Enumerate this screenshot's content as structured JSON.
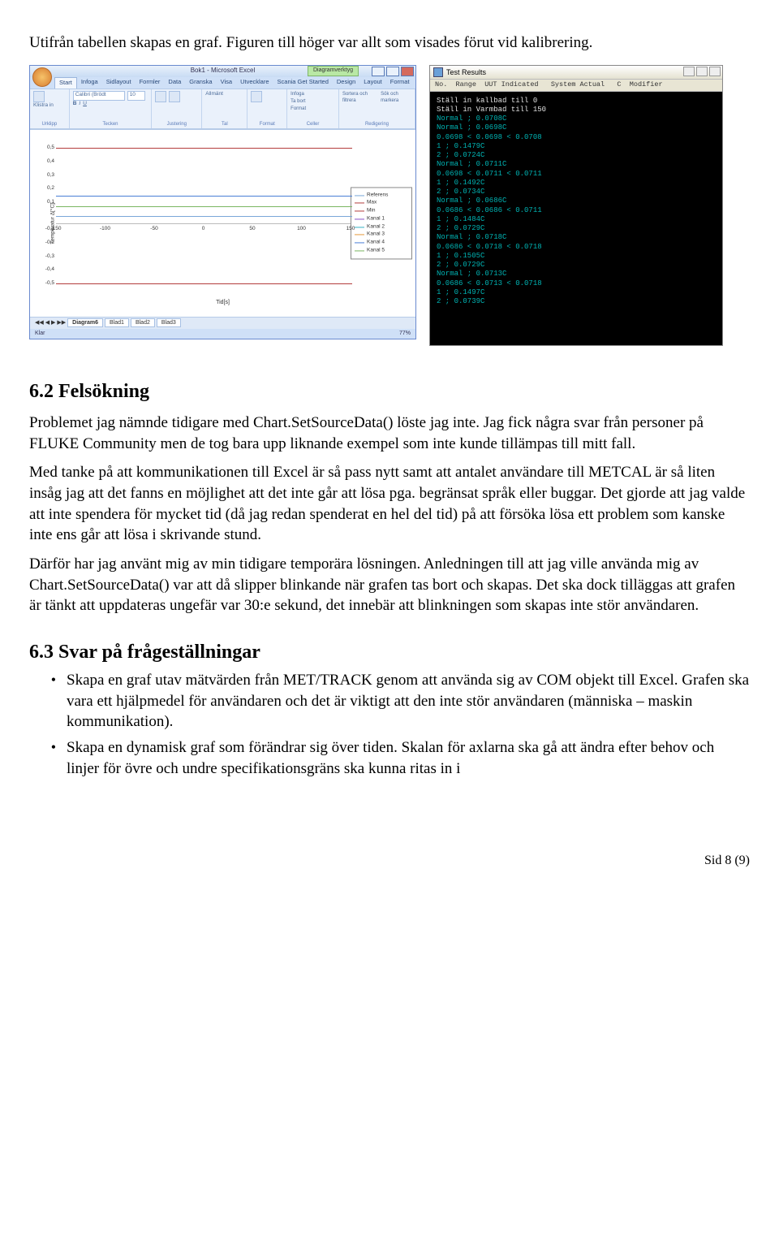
{
  "intro": "Utifrån tabellen skapas en graf. Figuren till höger var allt som visades förut vid kalibrering.",
  "excel": {
    "title": "Bok1 - Microsoft Excel",
    "context_tab": "Diagramverktyg",
    "tabs": [
      "Start",
      "Infoga",
      "Sidlayout",
      "Formler",
      "Data",
      "Granska",
      "Visa",
      "Utvecklare",
      "Scania Get Started",
      "Design",
      "Layout",
      "Format"
    ],
    "ribbon_groups": {
      "urklipp": "Urklipp",
      "klistra": "Klistra in",
      "tecken": "Tecken",
      "font": "Calibri (Brödt",
      "size": "10",
      "justering": "Justering",
      "allmant": "Allmänt",
      "tal": "Tal",
      "format": "Format",
      "celler": "Celler",
      "infoga": "Infoga",
      "tabort": "Ta bort",
      "sortera": "Sortera och filtrera",
      "sok": "Sök och markera",
      "redigering": "Redigering"
    },
    "sheets": [
      "Diagram6",
      "Blad1",
      "Blad2",
      "Blad3"
    ],
    "status_left": "Klar",
    "status_zoom": "77%"
  },
  "chart_data": {
    "type": "line",
    "xlabel": "Tid[s]",
    "ylabel": "Temperatur Δ[°C]",
    "xlim": [
      -150,
      150
    ],
    "ylim": [
      -0.6,
      0.6
    ],
    "xticks": [
      -150,
      -100,
      -50,
      0,
      50,
      100,
      150
    ],
    "yticks": [
      -0.5,
      -0.4,
      -0.3,
      -0.2,
      -0.1,
      0.1,
      0.2,
      0.3,
      0.4,
      0.5
    ],
    "series": [
      {
        "name": "Referens",
        "color": "#7aa7d8",
        "y": 0.0
      },
      {
        "name": "Max",
        "color": "#b33d3d",
        "y": 0.5
      },
      {
        "name": "Min",
        "color": "#b33d3d",
        "y": -0.5
      },
      {
        "name": "Kanal 1",
        "color": "#8851c9",
        "y": 0.07
      },
      {
        "name": "Kanal 2",
        "color": "#35b1c4",
        "y": 0.07
      },
      {
        "name": "Kanal 3",
        "color": "#e59a3c",
        "y": 0.07
      },
      {
        "name": "Kanal 4",
        "color": "#4a7fd6",
        "y": 0.15
      },
      {
        "name": "Kanal 5",
        "color": "#7bb662",
        "y": 0.07
      }
    ]
  },
  "console": {
    "title": "Test Results",
    "header": "No.  Range  UUT Indicated   System Actual   C  Modifier",
    "lines": [
      {
        "c": "w",
        "t": "Ställ in kallbad till 0"
      },
      {
        "c": "w",
        "t": "Ställ in Varmbad till 150"
      },
      {
        "c": "c",
        "t": "Normal ; 0.0708C"
      },
      {
        "c": "c",
        "t": "Normal ; 0.0698C"
      },
      {
        "c": "c",
        "t": "0.0698 < 0.0698 < 0.0708"
      },
      {
        "c": "c",
        "t": "1 ; 0.1479C"
      },
      {
        "c": "c",
        "t": "2 ; 0.0724C"
      },
      {
        "c": "c",
        "t": "Normal ; 0.0711C"
      },
      {
        "c": "c",
        "t": "0.0698 < 0.0711 < 0.0711"
      },
      {
        "c": "c",
        "t": "1 ; 0.1492C"
      },
      {
        "c": "c",
        "t": "2 ; 0.0734C"
      },
      {
        "c": "c",
        "t": "Normal ; 0.0686C"
      },
      {
        "c": "c",
        "t": "0.0686 < 0.0686 < 0.0711"
      },
      {
        "c": "c",
        "t": "1 ; 0.1484C"
      },
      {
        "c": "c",
        "t": "2 ; 0.0729C"
      },
      {
        "c": "c",
        "t": "Normal ; 0.0718C"
      },
      {
        "c": "c",
        "t": "0.0686 < 0.0718 < 0.0718"
      },
      {
        "c": "c",
        "t": "1 ; 0.1505C"
      },
      {
        "c": "c",
        "t": "2 ; 0.0729C"
      },
      {
        "c": "c",
        "t": "Normal ; 0.0713C"
      },
      {
        "c": "c",
        "t": "0.0686 < 0.0713 < 0.0718"
      },
      {
        "c": "c",
        "t": "1 ; 0.1497C"
      },
      {
        "c": "c",
        "t": "2 ; 0.0739C"
      }
    ]
  },
  "sec62": {
    "heading": "6.2 Felsökning",
    "p1": "Problemet jag nämnde tidigare med Chart.SetSourceData() löste jag inte. Jag fick några svar från personer på FLUKE Community men de tog bara upp liknande exempel som inte kunde tillämpas till mitt fall.",
    "p2": "Med tanke på att kommunikationen till Excel är så pass nytt samt att antalet användare till METCAL är så liten insåg jag att det fanns en möjlighet att det inte går att lösa pga. begränsat språk eller buggar. Det gjorde att jag valde att inte spendera för mycket tid (då jag redan spenderat en hel del tid) på att försöka lösa ett problem som kanske inte ens går att lösa i skrivande stund.",
    "p3": "Därför har jag använt mig av min tidigare temporära lösningen. Anledningen till att jag ville använda mig av Chart.SetSourceData() var att då slipper blinkande när grafen tas bort och skapas. Det ska dock tilläggas att grafen är tänkt att uppdateras ungefär var 30:e sekund, det innebär att blinkningen som skapas inte stör användaren."
  },
  "sec63": {
    "heading": "6.3 Svar på frågeställningar",
    "items": [
      "Skapa en graf utav mätvärden från MET/TRACK genom att använda sig av COM objekt till Excel. Grafen ska vara ett hjälpmedel för användaren och det är viktigt att den inte stör användaren (människa – maskin kommunikation).",
      "Skapa en dynamisk graf som förändrar sig över tiden. Skalan för axlarna ska gå att ändra efter behov och linjer för övre och undre specifikationsgräns ska kunna ritas in i"
    ]
  },
  "page_footer": "Sid 8 (9)"
}
